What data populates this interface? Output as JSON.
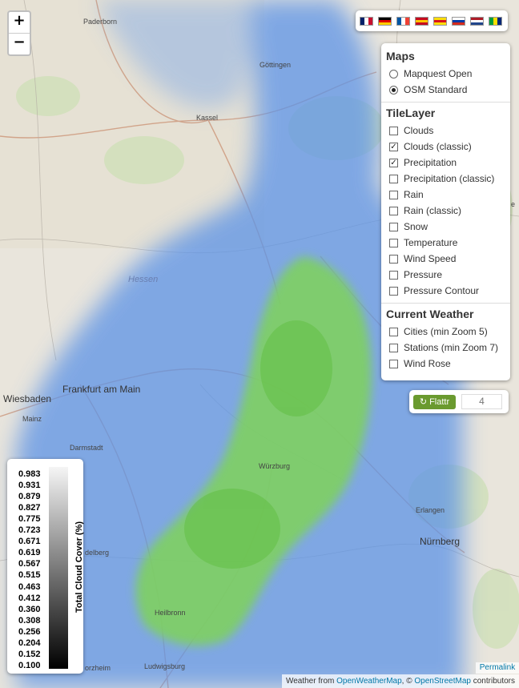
{
  "map": {
    "region_label": "Hessen",
    "cities": [
      {
        "name": "Paderborn"
      },
      {
        "name": "Göttingen"
      },
      {
        "name": "Kassel"
      },
      {
        "name": "Frankfurt am Main"
      },
      {
        "name": "Wiesbaden"
      },
      {
        "name": "Mainz"
      },
      {
        "name": "Darmstadt"
      },
      {
        "name": "Würzburg"
      },
      {
        "name": "Erlangen"
      },
      {
        "name": "Nürnberg"
      },
      {
        "name": "Heilbronn"
      },
      {
        "name": "Ludwigsburg"
      },
      {
        "name": "delberg"
      },
      {
        "name": "orzheim"
      },
      {
        "name": "e"
      }
    ]
  },
  "zoom": {
    "in_label": "+",
    "out_label": "−"
  },
  "languages": [
    {
      "name": "english",
      "colors": [
        "#012169",
        "#ffffff",
        "#c8102e"
      ]
    },
    {
      "name": "german",
      "colors": [
        "#000000",
        "#dd0000",
        "#ffce00"
      ]
    },
    {
      "name": "french",
      "colors": [
        "#0055a4",
        "#ffffff",
        "#ef4135"
      ]
    },
    {
      "name": "spanish",
      "colors": [
        "#c60b1e",
        "#ffc400",
        "#c60b1e"
      ]
    },
    {
      "name": "catalan",
      "colors": [
        "#fcdd09",
        "#da121a",
        "#fcdd09"
      ]
    },
    {
      "name": "russian",
      "colors": [
        "#ffffff",
        "#0039a6",
        "#d52b1e"
      ]
    },
    {
      "name": "dutch",
      "colors": [
        "#ae1c28",
        "#ffffff",
        "#21468b"
      ]
    },
    {
      "name": "brazilian",
      "colors": [
        "#009c3b",
        "#ffdf00",
        "#002776"
      ]
    }
  ],
  "layer_control": {
    "maps_heading": "Maps",
    "base_maps": [
      {
        "label": "Mapquest Open",
        "selected": false
      },
      {
        "label": "OSM Standard",
        "selected": true
      }
    ],
    "tile_heading": "TileLayer",
    "tile_layers": [
      {
        "label": "Clouds",
        "checked": false
      },
      {
        "label": "Clouds (classic)",
        "checked": true
      },
      {
        "label": "Precipitation",
        "checked": true
      },
      {
        "label": "Precipitation (classic)",
        "checked": false
      },
      {
        "label": "Rain",
        "checked": false
      },
      {
        "label": "Rain (classic)",
        "checked": false
      },
      {
        "label": "Snow",
        "checked": false
      },
      {
        "label": "Temperature",
        "checked": false
      },
      {
        "label": "Wind Speed",
        "checked": false
      },
      {
        "label": "Pressure",
        "checked": false
      },
      {
        "label": "Pressure Contour",
        "checked": false
      }
    ],
    "weather_heading": "Current Weather",
    "weather_layers": [
      {
        "label": "Cities (min Zoom 5)",
        "checked": false
      },
      {
        "label": "Stations (min Zoom 7)",
        "checked": false
      },
      {
        "label": "Wind Rose",
        "checked": false
      }
    ]
  },
  "flattr": {
    "label": "Flattr",
    "count": "4"
  },
  "legend": {
    "title": "Total Cloud Cover (%)",
    "values": [
      "0.983",
      "0.931",
      "0.879",
      "0.827",
      "0.775",
      "0.723",
      "0.671",
      "0.619",
      "0.567",
      "0.515",
      "0.463",
      "0.412",
      "0.360",
      "0.308",
      "0.256",
      "0.204",
      "0.152",
      "0.100"
    ]
  },
  "permalink": "Permalink",
  "attribution": {
    "prefix": "Weather from ",
    "owm": "OpenWeatherMap",
    "mid": ", © ",
    "osm": "OpenStreetMap",
    "suffix": " contributors"
  },
  "colors": {
    "land": "#e9e5dc",
    "clouds_blue": "#5c93e6",
    "precip_green": "#7fd35a",
    "link": "#0078a8"
  }
}
